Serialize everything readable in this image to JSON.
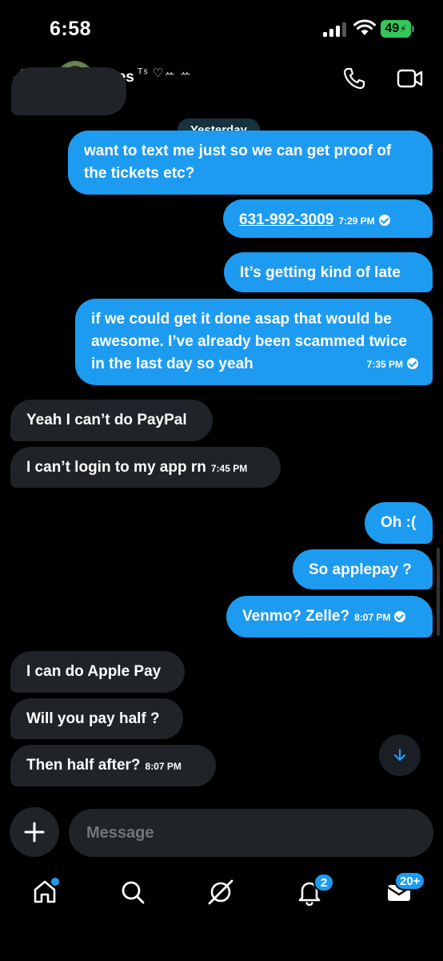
{
  "status_bar": {
    "time": "6:58",
    "battery": "49"
  },
  "header": {
    "name": "Des",
    "name_decor": "ᵀˢ ♡ꕀ ꕀ"
  },
  "chat": {
    "date_separator": "Yesterday",
    "messages": [
      {
        "text": "want to text me just so we can get proof of the tickets etc?"
      },
      {
        "text": "631-992-3009",
        "time": "7:29 PM"
      },
      {
        "text": "It’s getting kind of late"
      },
      {
        "text": "if we could get it done asap that would be awesome. I’ve already been scammed twice in the last day so yeah",
        "time": "7:35 PM"
      },
      {
        "text": "Yeah I can’t do PayPal"
      },
      {
        "text": "I can’t login to my app rn",
        "time": "7:45 PM"
      },
      {
        "text": "Oh :("
      },
      {
        "text": "So applepay ?"
      },
      {
        "text": "Venmo? Zelle?",
        "time": "8:07 PM"
      },
      {
        "text": "I can do Apple Pay"
      },
      {
        "text": "Will you pay half ?"
      },
      {
        "text": "Then half after?",
        "time": "8:07 PM"
      }
    ]
  },
  "composer": {
    "placeholder": "Message"
  },
  "tab_bar": {
    "notifications_badge": "2",
    "messages_badge": "20+",
    "icons": [
      "home-icon",
      "search-icon",
      "grok-icon",
      "bell-icon",
      "mail-icon"
    ]
  },
  "colors": {
    "accent": "#1d9bf0",
    "received_bubble": "#202327",
    "background": "#000000"
  }
}
